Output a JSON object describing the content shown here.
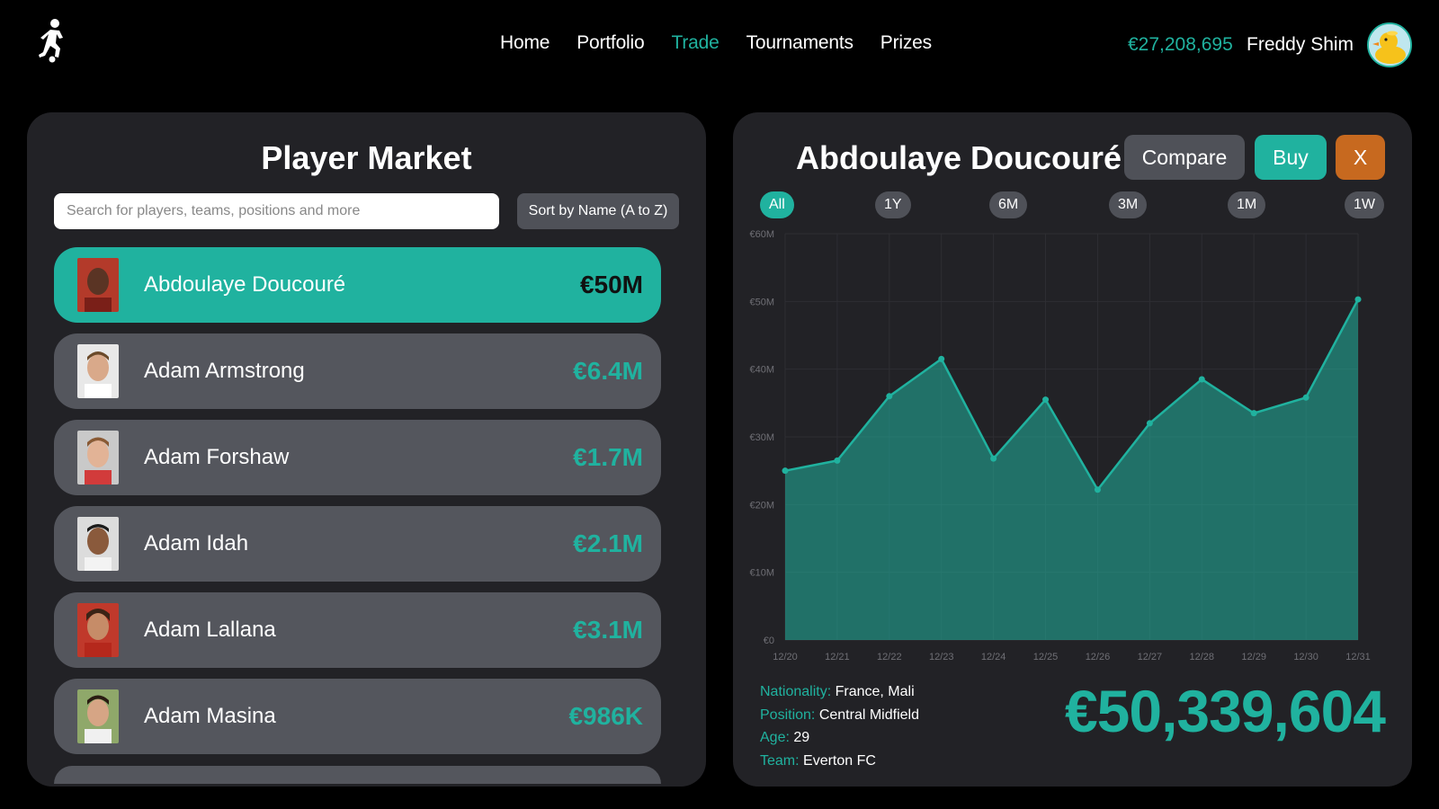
{
  "nav": {
    "items": [
      {
        "label": "Home",
        "active": false
      },
      {
        "label": "Portfolio",
        "active": false
      },
      {
        "label": "Trade",
        "active": true
      },
      {
        "label": "Tournaments",
        "active": false
      },
      {
        "label": "Prizes",
        "active": false
      }
    ],
    "balance": "€27,208,695",
    "username": "Freddy Shim",
    "avatar_icon": "rubber-duck-icon"
  },
  "colors": {
    "accent": "#20b29f",
    "panel": "#222226",
    "row": "#54565d",
    "close": "#c7691f"
  },
  "market": {
    "title": "Player Market",
    "search_placeholder": "Search for players, teams, positions and more",
    "sort_label": "Sort by Name (A to Z)",
    "players": [
      {
        "name": "Abdoulaye Doucouré",
        "value": "€50M",
        "selected": true,
        "photo_bg": "#b33a2a"
      },
      {
        "name": "Adam Armstrong",
        "value": "€6.4M",
        "selected": false,
        "photo_bg": "#e8e8e8"
      },
      {
        "name": "Adam Forshaw",
        "value": "€1.7M",
        "selected": false,
        "photo_bg": "#c9c9c9"
      },
      {
        "name": "Adam Idah",
        "value": "€2.1M",
        "selected": false,
        "photo_bg": "#dcdcdc"
      },
      {
        "name": "Adam Lallana",
        "value": "€3.1M",
        "selected": false,
        "photo_bg": "#c0392b"
      },
      {
        "name": "Adam Masina",
        "value": "€986K",
        "selected": false,
        "photo_bg": "#8fa86a"
      }
    ]
  },
  "detail": {
    "name": "Abdoulaye Doucouré",
    "compare_label": "Compare",
    "buy_label": "Buy",
    "close_label": "X",
    "ranges": [
      {
        "label": "All",
        "active": true
      },
      {
        "label": "1Y",
        "active": false
      },
      {
        "label": "6M",
        "active": false
      },
      {
        "label": "3M",
        "active": false
      },
      {
        "label": "1M",
        "active": false
      },
      {
        "label": "1W",
        "active": false
      }
    ],
    "info": [
      {
        "key": "Nationality:",
        "value": "France, Mali"
      },
      {
        "key": "Position:",
        "value": "Central Midfield"
      },
      {
        "key": "Age:",
        "value": "29"
      },
      {
        "key": "Team:",
        "value": "Everton FC"
      }
    ],
    "current_value": "€50,339,604"
  },
  "chart_data": {
    "type": "area",
    "x": [
      "12/20",
      "12/21",
      "12/22",
      "12/23",
      "12/24",
      "12/25",
      "12/26",
      "12/27",
      "12/28",
      "12/29",
      "12/30",
      "12/31"
    ],
    "values": [
      25.0,
      26.5,
      36.0,
      41.5,
      26.8,
      35.5,
      22.2,
      32.0,
      38.5,
      33.5,
      35.8,
      50.3
    ],
    "y_ticks": [
      "€0",
      "€10M",
      "€20M",
      "€30M",
      "€40M",
      "€50M",
      "€60M"
    ],
    "ylim": [
      0,
      60
    ],
    "grid": true,
    "color": "#20b29f"
  }
}
